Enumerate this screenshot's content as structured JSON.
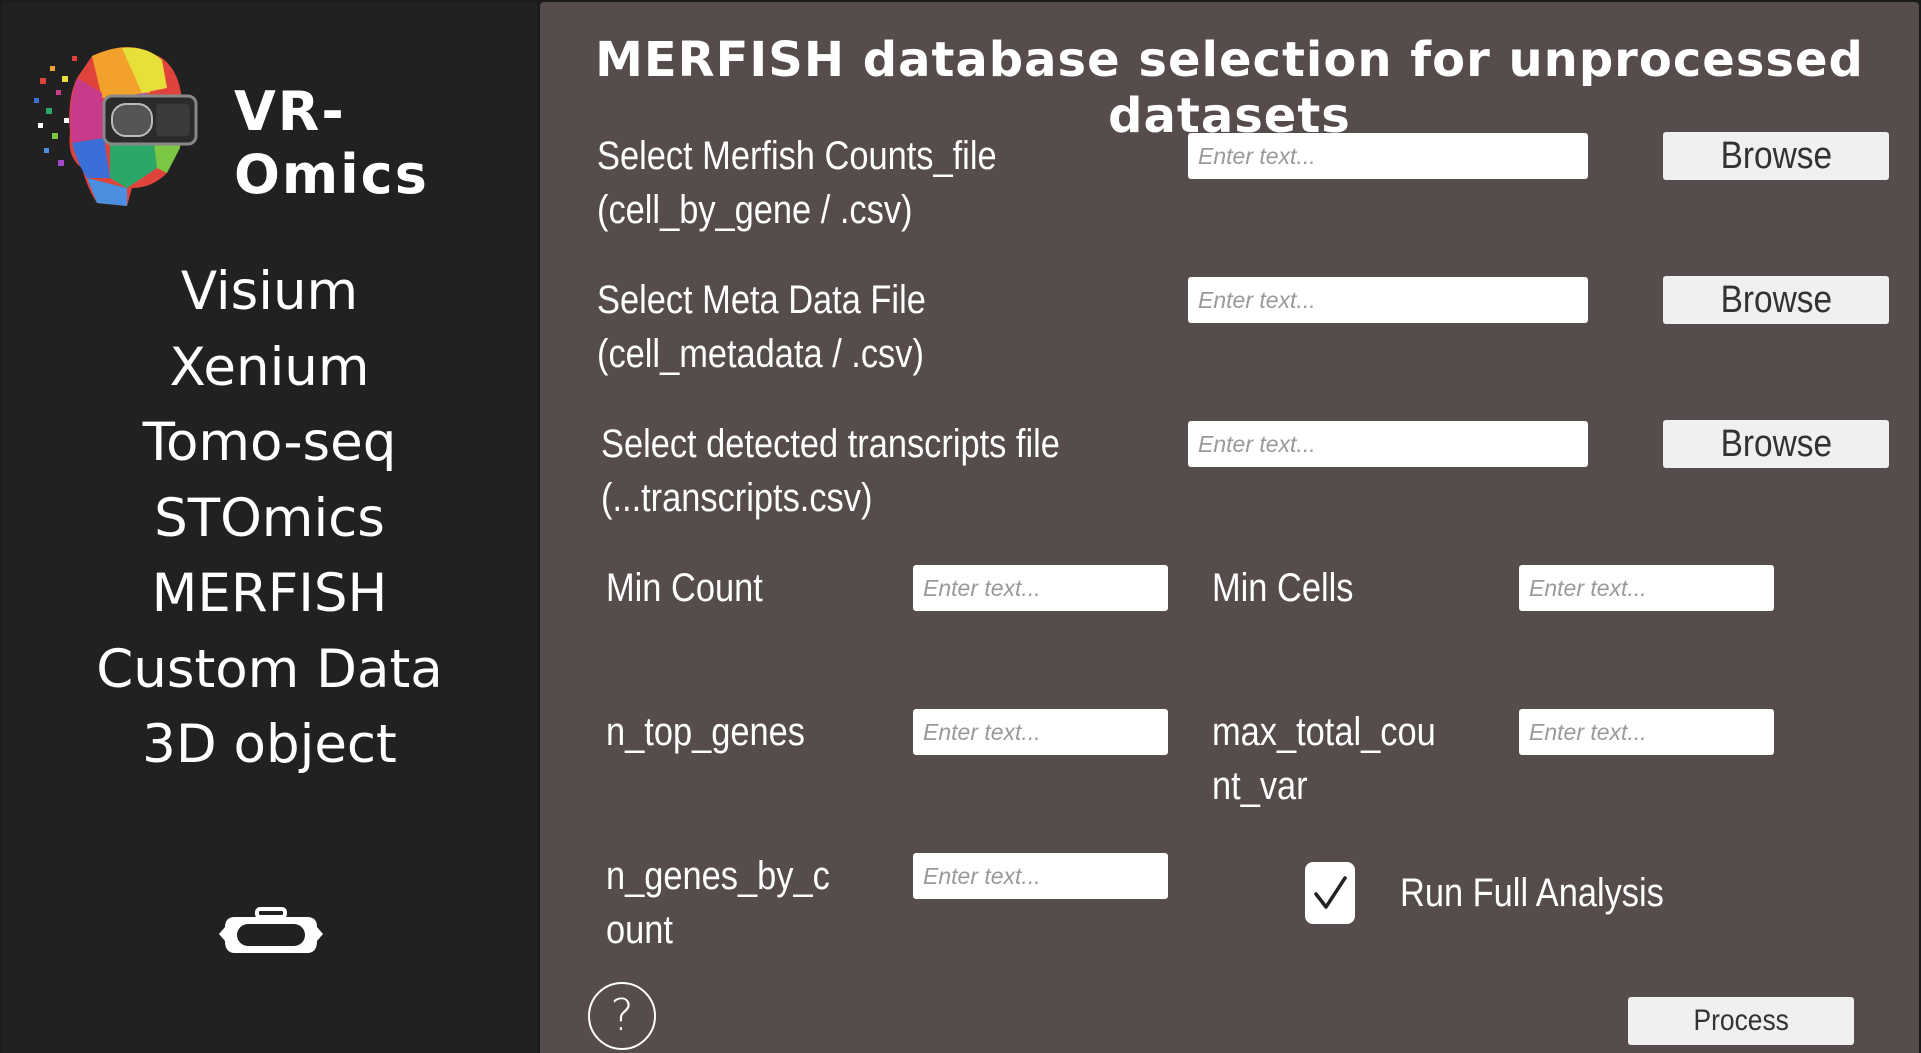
{
  "sidebar": {
    "app_title": "VR-Omics",
    "items": [
      {
        "label": "Visium"
      },
      {
        "label": "Xenium"
      },
      {
        "label": "Tomo-seq"
      },
      {
        "label": "STOmics"
      },
      {
        "label": "MERFISH"
      },
      {
        "label": "Custom Data"
      },
      {
        "label": "3D object"
      }
    ],
    "vr_icon": "vr-headset-icon"
  },
  "main": {
    "title": "MERFISH database selection for unprocessed datasets",
    "placeholder": "Enter text...",
    "files": [
      {
        "label_line1": "Select Merfish Counts_file",
        "label_line2": "(cell_by_gene / .csv)",
        "button": "Browse"
      },
      {
        "label_line1": "Select Meta Data File",
        "label_line2": "(cell_metadata / .csv)",
        "button": "Browse"
      },
      {
        "label_line1": "Select detected transcripts file",
        "label_line2": "(...transcripts.csv)",
        "button": "Browse"
      }
    ],
    "params": {
      "min_count": "Min Count",
      "min_cells": "Min Cells",
      "n_top_genes": "n_top_genes",
      "max_total_count_var_line1": "max_total_cou",
      "max_total_count_var_line2": "nt_var",
      "n_genes_by_count_line1": "n_genes_by_c",
      "n_genes_by_count_line2": "ount"
    },
    "run_full_analysis": {
      "label": "Run Full Analysis",
      "checked": true
    },
    "help_icon": "question-mark-icon",
    "help_symbol": "?",
    "process_label": "Process"
  }
}
